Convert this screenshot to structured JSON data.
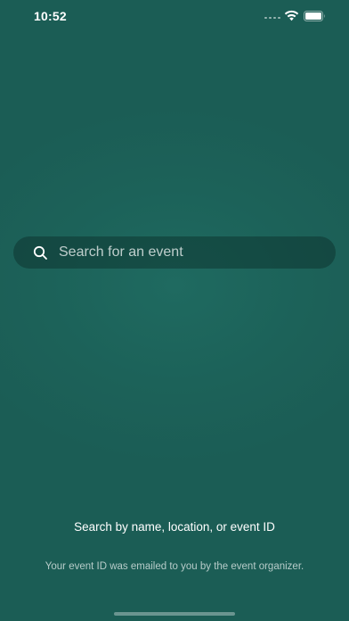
{
  "status_bar": {
    "time": "10:52",
    "signal_icon": "cellular-signal-icon",
    "wifi_icon": "wifi-icon",
    "battery_icon": "battery-icon"
  },
  "search": {
    "icon": "search-icon",
    "placeholder": "Search for an event"
  },
  "helper": {
    "title": "Search by name, location, or event ID",
    "subtitle": "Your event ID was emailed to you by the event organizer."
  },
  "colors": {
    "background": "#1b5d55",
    "search_bar": "#123f39",
    "text_primary": "#ffffff"
  }
}
